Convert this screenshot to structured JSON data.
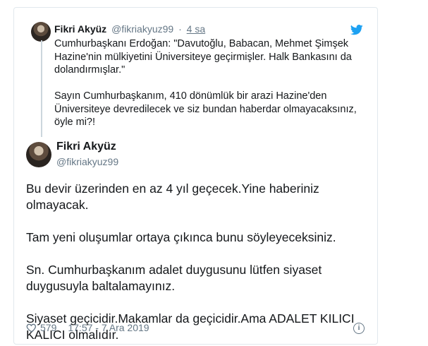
{
  "quoted_tweet": {
    "name": "Fikri Akyüz",
    "handle": "@fikriakyuz99",
    "separator": "·",
    "time": "4 sa",
    "text": "Cumhurbaşkanı Erdoğan: \"Davutoğlu, Babacan, Mehmet Şimşek Hazine'nin mülkiyetini Üniversiteye geçirmişler. Halk Bankasını da dolandırmışlar.\"\n\nSayın Cumhurbaşkanım, 410 dönümlük bir arazi Hazine'den Üniversiteye devredilecek ve siz bundan haberdar olmayacaksınız, öyle mi?!"
  },
  "main_tweet": {
    "name": "Fikri Akyüz",
    "handle": "@fikriakyuz99",
    "text": "Bu devir üzerinden en az 4 yıl geçecek.Yine haberiniz olmayacak.\n\nTam yeni oluşumlar ortaya çıkınca bunu söyleyeceksiniz.\n\nSn. Cumhurbaşkanım adalet duygusunu lütfen siyaset duygusuyla baltalamayınız.\n\nSiyaset geçicidir.Makamlar da geçicidir.Ama ADALET KILICI KALICI olmalıdır.",
    "likes": "579",
    "timestamp": "17:57 - 7 Ara 2019"
  },
  "icons": {
    "brand": "twitter-bird-icon",
    "like": "heart-icon",
    "info": "info-icon"
  },
  "colors": {
    "twitter_blue": "#1da1f2",
    "secondary_text": "#657786",
    "border": "#e1e8ed"
  }
}
